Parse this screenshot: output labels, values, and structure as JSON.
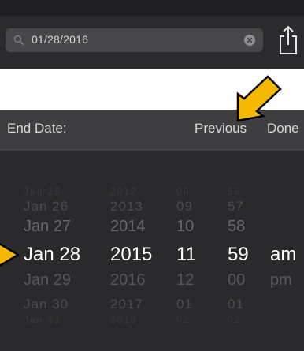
{
  "search": {
    "value": "01/28/2016"
  },
  "toolbar": {
    "title": "End Date:",
    "previous_label": "Previous",
    "done_label": "Done"
  },
  "picker": {
    "rows": [
      {
        "date": "Jan 25",
        "year": "2012",
        "hour": "08",
        "minute": "56",
        "ampm": ""
      },
      {
        "date": "Jan 26",
        "year": "2013",
        "hour": "09",
        "minute": "57",
        "ampm": ""
      },
      {
        "date": "Jan 27",
        "year": "2014",
        "hour": "10",
        "minute": "58",
        "ampm": ""
      },
      {
        "date": "Jan 28",
        "year": "2015",
        "hour": "11",
        "minute": "59",
        "ampm": "am"
      },
      {
        "date": "Jan 29",
        "year": "2016",
        "hour": "12",
        "minute": "00",
        "ampm": "pm"
      },
      {
        "date": "Jan 30",
        "year": "2017",
        "hour": "01",
        "minute": "01",
        "ampm": ""
      },
      {
        "date": "Jan 31",
        "year": "2018",
        "hour": "02",
        "minute": "02",
        "ampm": ""
      }
    ],
    "selected_index": 3
  },
  "colors": {
    "bar_background": "#2b2b2d",
    "toolbar_background": "#3f3f41",
    "picker_background": "#2a2a2c",
    "annotation_arrow": "#f5b800"
  },
  "icons": {
    "search": "search-icon",
    "clear": "clear-icon",
    "share": "share-icon",
    "annotation": "arrow-pointer-icon"
  }
}
